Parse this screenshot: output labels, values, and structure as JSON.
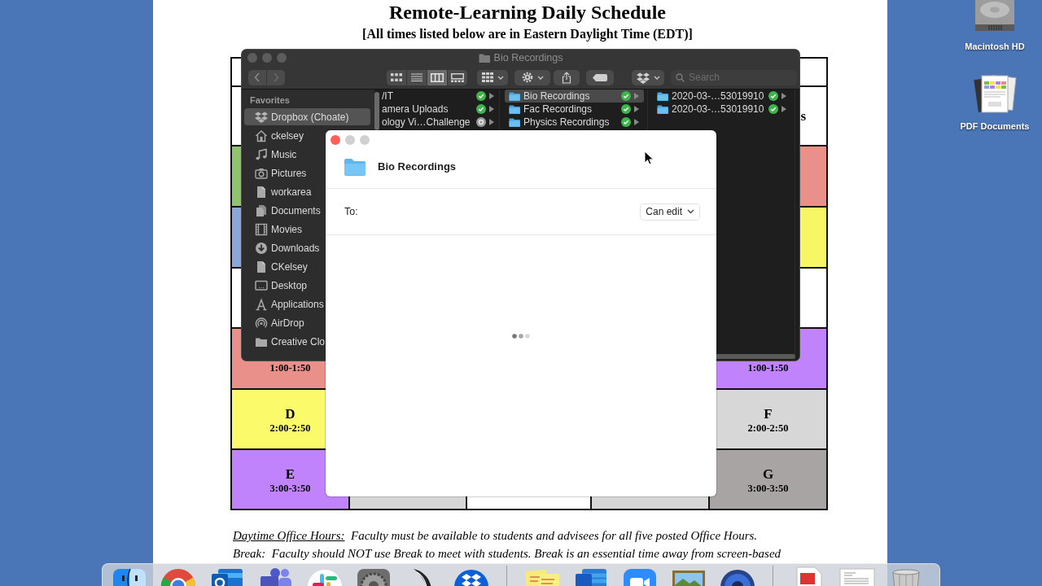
{
  "desktop_icons": [
    {
      "label": "Macintosh HD",
      "kind": "drive"
    },
    {
      "label": "PDF Documents",
      "kind": "pdf"
    }
  ],
  "document": {
    "title": "Remote-Learning Daily Schedule",
    "subtitle": "[All times listed below are in Eastern Daylight Time (EDT)]",
    "schedule": {
      "first_column": [
        {
          "color": "#ffffff"
        },
        {
          "color": "#ffffff"
        },
        {
          "color": "#8fc46d"
        },
        {
          "color": "#8ea5dc"
        },
        {
          "color": "#ffffff"
        },
        {
          "color": "#e9908b",
          "time": "1:00-1:50"
        },
        {
          "color": "#fafa6a",
          "letter": "D",
          "time": "2:00-2:50"
        },
        {
          "color": "#c083fb",
          "letter": "E",
          "time": "3:00-3:50"
        }
      ],
      "middle_bottom_cells": [
        {
          "color": "#d6d6d6"
        },
        {
          "color": "#ffffff"
        },
        {
          "color": "#d6d6d6"
        }
      ],
      "last_column": [
        {
          "color": "#ffffff"
        },
        {
          "color": "#ffffff",
          "heading": "s"
        },
        {
          "color": "#e9908b"
        },
        {
          "color": "#f7f765"
        },
        {
          "color": "#ffffff"
        },
        {
          "color": "#c083fb",
          "time": "1:00-1:50"
        },
        {
          "color": "#d7d7d7",
          "letter": "F",
          "time": "2:00-2:50"
        },
        {
          "color": "#a8a4a4",
          "letter": "G",
          "time": "3:00-3:50"
        }
      ]
    },
    "notes": [
      {
        "label": "Daytime Office Hours:",
        "underlined": true,
        "text": "Faculty must be available to students and advisees for all five posted Office Hours."
      },
      {
        "label": "Break:",
        "underlined": false,
        "text": "Faculty should NOT use Break to meet with students. Break is an essential time away from screen-based"
      }
    ]
  },
  "finder": {
    "title": "Bio Recordings",
    "view_modes": [
      {
        "kind": "icons",
        "selected": false
      },
      {
        "kind": "list",
        "selected": false
      },
      {
        "kind": "columns",
        "selected": true
      },
      {
        "kind": "gallery",
        "selected": false
      }
    ],
    "search": {
      "placeholder": "Search"
    },
    "sidebar": {
      "heading": "Favorites",
      "items": [
        {
          "label": "Dropbox (Choate)",
          "kind": "dropbox",
          "selected": true
        },
        {
          "label": "ckelsey",
          "kind": "home",
          "selected": false
        },
        {
          "label": "Music",
          "kind": "music",
          "selected": false
        },
        {
          "label": "Pictures",
          "kind": "pictures",
          "selected": false
        },
        {
          "label": "workarea",
          "kind": "file",
          "selected": false
        },
        {
          "label": "Documents",
          "kind": "documents",
          "selected": false
        },
        {
          "label": "Movies",
          "kind": "movies",
          "selected": false
        },
        {
          "label": "Downloads",
          "kind": "downloads",
          "selected": false
        },
        {
          "label": "CKelsey",
          "kind": "file",
          "selected": false
        },
        {
          "label": "Desktop",
          "kind": "desktop",
          "selected": false
        },
        {
          "label": "Applications",
          "kind": "applications",
          "selected": false
        },
        {
          "label": "AirDrop",
          "kind": "airdrop",
          "selected": false
        },
        {
          "label": "Creative Clo",
          "kind": "folder",
          "selected": false
        }
      ]
    },
    "columns": [
      {
        "items": [
          {
            "name": "/IT",
            "kind": "clipped",
            "synced": true,
            "selected": false
          },
          {
            "name": "amera Uploads",
            "kind": "clipped",
            "synced": true,
            "selected": false
          },
          {
            "name": "ology Vi…Challenge",
            "kind": "clipped",
            "synced": false,
            "selected": false
          }
        ]
      },
      {
        "items": [
          {
            "name": "Bio Recordings",
            "kind": "folder",
            "synced": true,
            "selected": true
          },
          {
            "name": "Fac Recordings",
            "kind": "folder",
            "synced": true,
            "selected": false
          },
          {
            "name": "Physics Recordings",
            "kind": "folder",
            "synced": true,
            "selected": false
          }
        ]
      },
      {
        "items": [
          {
            "name": "2020-03-…53019910",
            "kind": "folder",
            "synced": true,
            "selected": false
          },
          {
            "name": "2020-03-…53019910",
            "kind": "folder",
            "synced": true,
            "selected": false
          }
        ]
      }
    ]
  },
  "share_dialog": {
    "title": "Bio Recordings",
    "to_label": "To:",
    "permission": "Can edit",
    "loading": true
  }
}
